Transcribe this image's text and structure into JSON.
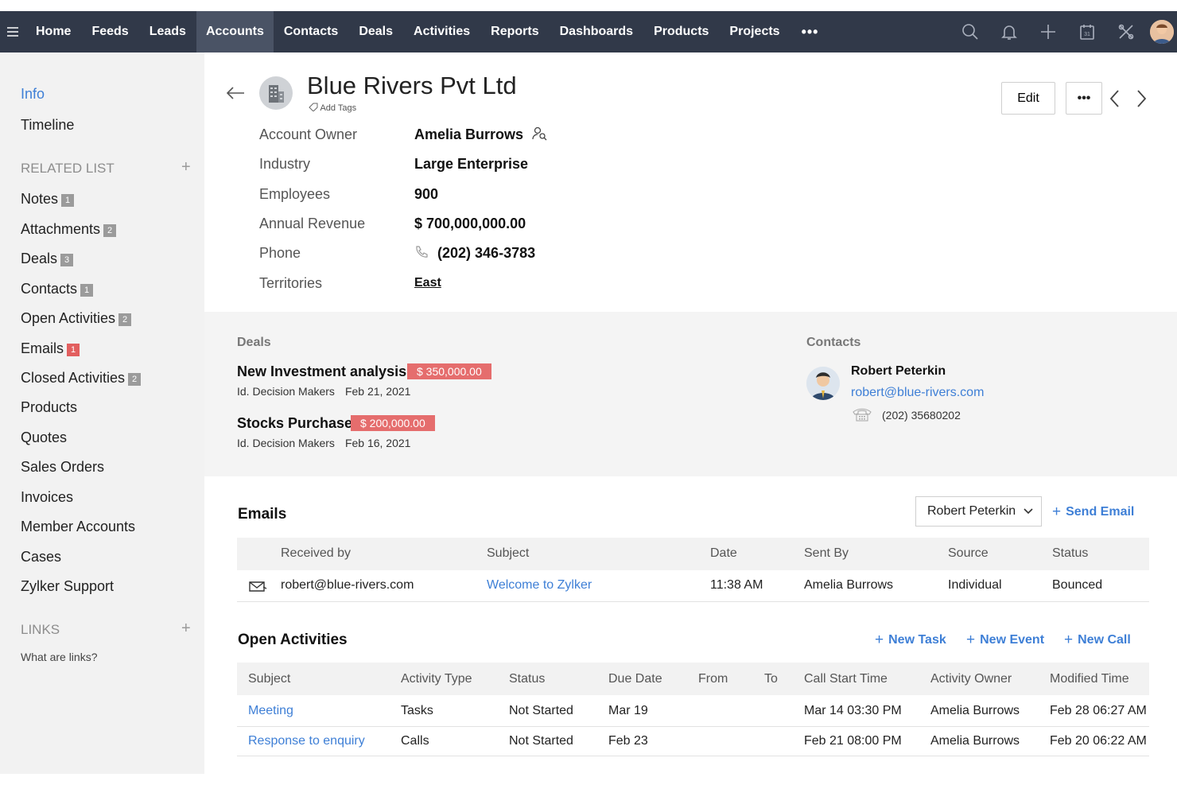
{
  "nav": {
    "items": [
      "Home",
      "Feeds",
      "Leads",
      "Accounts",
      "Contacts",
      "Deals",
      "Activities",
      "Reports",
      "Dashboards",
      "Products",
      "Projects"
    ],
    "active": "Accounts",
    "more": "•••",
    "icons": [
      "search-icon",
      "bell-icon",
      "plus-icon",
      "calendar-icon",
      "tools-icon",
      "avatar"
    ],
    "calendar_day": "31"
  },
  "sidebar": {
    "info": "Info",
    "timeline": "Timeline",
    "related_head": "RELATED LIST",
    "related": [
      {
        "label": "Notes",
        "count": "1"
      },
      {
        "label": "Attachments",
        "count": "2"
      },
      {
        "label": "Deals",
        "count": "3"
      },
      {
        "label": "Contacts",
        "count": "1"
      },
      {
        "label": "Open Activities",
        "count": "2"
      },
      {
        "label": "Emails",
        "count": "1"
      },
      {
        "label": "Closed Activities",
        "count": "2"
      },
      {
        "label": "Products",
        "count": ""
      },
      {
        "label": "Quotes",
        "count": ""
      },
      {
        "label": "Sales Orders",
        "count": ""
      },
      {
        "label": "Invoices",
        "count": ""
      },
      {
        "label": "Member Accounts",
        "count": ""
      },
      {
        "label": "Cases",
        "count": ""
      },
      {
        "label": "Zylker Support",
        "count": ""
      }
    ],
    "links_head": "LINKS",
    "links_help": "What are links?",
    "plus": "+"
  },
  "account": {
    "title": "Blue Rivers Pvt Ltd",
    "add_tags": "Add Tags",
    "edit": "Edit",
    "more": "•••",
    "fields": [
      {
        "label": "Account Owner",
        "value": "Amelia Burrows"
      },
      {
        "label": "Industry",
        "value": "Large Enterprise"
      },
      {
        "label": "Employees",
        "value": "900"
      },
      {
        "label": "Annual Revenue",
        "value": "$ 700,000,000.00"
      },
      {
        "label": "Phone",
        "value": "(202) 346-3783"
      },
      {
        "label": "Territories",
        "value": "East"
      }
    ]
  },
  "deals": {
    "heading": "Deals",
    "items": [
      {
        "name": "New Investment analysis",
        "amount": "$ 350,000.00",
        "stage": "Id. Decision Makers",
        "date": "Feb 21, 2021"
      },
      {
        "name": "Stocks Purchase",
        "amount": "$ 200,000.00",
        "stage": "Id. Decision Makers",
        "date": "Feb 16, 2021"
      }
    ]
  },
  "contacts": {
    "heading": "Contacts",
    "name": "Robert Peterkin",
    "email": "robert@blue-rivers.com",
    "phone": "(202) 35680202"
  },
  "emails": {
    "title": "Emails",
    "selector": "Robert Peterkin",
    "send": "Send Email",
    "columns": [
      "Received by",
      "Subject",
      "Date",
      "Sent By",
      "Source",
      "Status"
    ],
    "rows": [
      {
        "received_by": "robert@blue-rivers.com",
        "subject": "Welcome to Zylker",
        "date": "11:38 AM",
        "sent_by": "Amelia Burrows",
        "source": "Individual",
        "status": "Bounced"
      }
    ]
  },
  "activities": {
    "title": "Open Activities",
    "new_task": "New Task",
    "new_event": "New Event",
    "new_call": "New Call",
    "columns": [
      "Subject",
      "Activity Type",
      "Status",
      "Due Date",
      "From",
      "To",
      "Call Start Time",
      "Activity Owner",
      "Modified Time"
    ],
    "rows": [
      {
        "subject": "Meeting",
        "type": "Tasks",
        "status": "Not Started",
        "due": "Mar 19",
        "from": "",
        "to": "",
        "call_start": "Mar 14 03:30 PM",
        "owner": "Amelia Burrows",
        "modified": "Feb 28 06:27 AM"
      },
      {
        "subject": "Response to enquiry",
        "type": "Calls",
        "status": "Not Started",
        "due": "Feb 23",
        "from": "",
        "to": "",
        "call_start": "Feb 21 08:00 PM",
        "owner": "Amelia Burrows",
        "modified": "Feb 20 06:22 AM"
      }
    ]
  },
  "colors": {
    "nav_bg": "#313949",
    "accent": "#3e7fd6",
    "deal_badge": "#e56d6d",
    "email_badge": "#e25f5f"
  }
}
